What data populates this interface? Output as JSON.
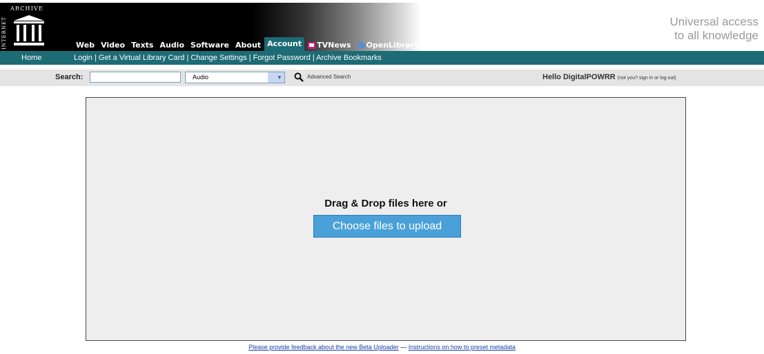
{
  "logo": {
    "side_text": "INTERNET",
    "top_text": "ARCHIVE"
  },
  "nav": {
    "items": [
      "Web",
      "Video",
      "Texts",
      "Audio",
      "Software",
      "About",
      "Account",
      "TVNews",
      "OpenLibrary"
    ],
    "active": "Account"
  },
  "tagline": [
    "Universal access",
    "to all knowledge"
  ],
  "subbar": {
    "home": "Home",
    "links": "Login | Get a Virtual Library Card | Change Settings | Forgot Password | Archive Bookmarks"
  },
  "search": {
    "label": "Search:",
    "value": "",
    "select_value": "Audio",
    "advanced": "Advanced Search",
    "hello_prefix": "Hello DigitalPOWRR",
    "hello_small": "(not you? sign in or log out)"
  },
  "upload": {
    "drop_text": "Drag & Drop files here or",
    "choose_button": "Choose files to upload"
  },
  "footer": {
    "feedback_link": "Please provide feedback about the new Beta Uploader",
    "separator": "—",
    "instructions_link": "Instructions on how to preset metadata"
  },
  "colors": {
    "teal": "#1d6b75",
    "button": "#4aa0d8",
    "link": "#1b3fa7"
  }
}
